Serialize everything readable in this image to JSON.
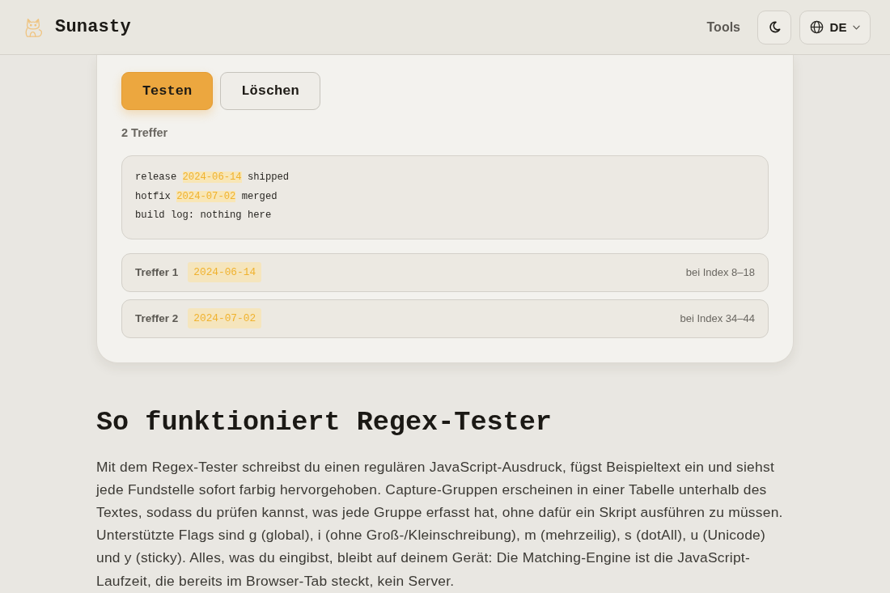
{
  "header": {
    "brand": "Sunasty",
    "nav": [
      {
        "label": "Tools"
      }
    ],
    "language": {
      "label": "DE"
    }
  },
  "tester": {
    "buttons": [
      {
        "label": "Testen",
        "kind": "primary"
      },
      {
        "label": "Löschen",
        "kind": "secondary"
      }
    ],
    "match_count": "2 Treffer",
    "output_lines": [
      {
        "segments": [
          {
            "text": "release ",
            "match": false
          },
          {
            "text": "2024-06-14",
            "match": true
          },
          {
            "text": " shipped",
            "match": false
          }
        ]
      },
      {
        "segments": [
          {
            "text": "hotfix ",
            "match": false
          },
          {
            "text": "2024-07-02",
            "match": true
          },
          {
            "text": " merged",
            "match": false
          }
        ]
      },
      {
        "segments": [
          {
            "text": "build log: nothing here",
            "match": false
          }
        ]
      }
    ],
    "matches": [
      {
        "label": "Treffer 1",
        "value": "2024-06-14",
        "position": "bei Index 8–18"
      },
      {
        "label": "Treffer 2",
        "value": "2024-07-02",
        "position": "bei Index 34–44"
      }
    ]
  },
  "article": {
    "heading": "So funktioniert Regex-Tester",
    "body": "Mit dem Regex-Tester schreibst du einen regulären JavaScript-Ausdruck, fügst Beispieltext ein und siehst jede Fundstelle sofort farbig hervorgehoben. Capture-Gruppen erscheinen in einer Tabelle unterhalb des Textes, sodass du prüfen kannst, was jede Gruppe erfasst hat, ohne dafür ein Skript ausführen zu müssen. Unterstützte Flags sind g (global), i (ohne Groß-/Kleinschreibung), m (mehrzeilig), s (dotAll), u (Unicode) und y (sticky). Alles, was du eingibst, bleibt auf deinem Gerät: Die Matching-Engine ist die JavaScript-Laufzeit, die bereits im Browser-Tab steckt, kein Server."
  }
}
